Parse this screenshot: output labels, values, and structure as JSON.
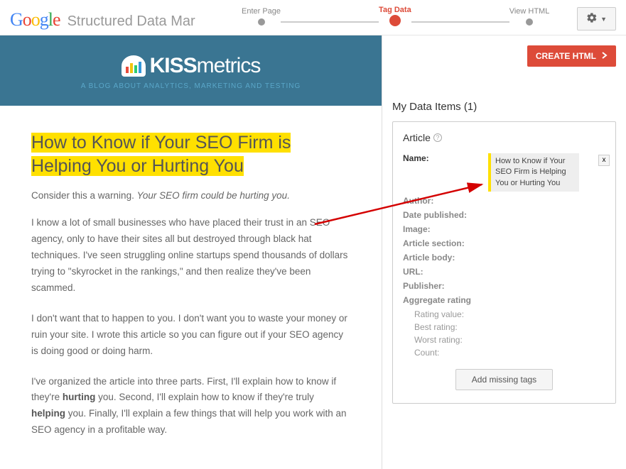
{
  "header": {
    "product": "Structured Data Mar",
    "steps": [
      "Enter Page",
      "Tag Data",
      "View HTML"
    ],
    "active_step": 1
  },
  "preview": {
    "site_logo": "KISSmetrics",
    "site_tag": "A BLOG ABOUT ANALYTICS, MARKETING AND TESTING",
    "title": "How to Know if Your SEO Firm is Helping You or Hurting You",
    "intro_plain": "Consider this a warning. ",
    "intro_em": "Your SEO firm could be hurting you.",
    "p1": "I know a lot of small businesses who have placed their trust in an SEO agency, only to have their sites all but destroyed through black hat techniques. I've seen struggling online startups spend thousands of dollars trying to \"skyrocket in the rankings,\" and then realize they've been scammed.",
    "p2": "I don't want that to happen to you. I don't want you to waste your money or ruin your site. I wrote this article so you can figure out if your SEO agency is doing good or doing harm.",
    "p3a": "I've organized the article into three parts. First, I'll explain how to know if they're ",
    "p3b": "hurting",
    "p3c": " you. Second, I'll explain how to know if they're truly ",
    "p3d": "helping",
    "p3e": " you. Finally, I'll explain a few things that will help you work with an SEO agency in a profitable way."
  },
  "sidebar": {
    "create_label": "CREATE HTML",
    "panel_title": "My Data Items (1)",
    "schema_type": "Article",
    "name_label": "Name:",
    "name_value": "How to Know if Your SEO Firm is Helping You or Hurting You",
    "x_label": "x",
    "fields": {
      "author": "Author:",
      "date": "Date published:",
      "image": "Image:",
      "section": "Article section:",
      "body": "Article body:",
      "url": "URL:",
      "publisher": "Publisher:",
      "agg": "Aggregate rating",
      "rv": "Rating value:",
      "br": "Best rating:",
      "wr": "Worst rating:",
      "cnt": "Count:"
    },
    "add_missing": "Add missing tags"
  }
}
